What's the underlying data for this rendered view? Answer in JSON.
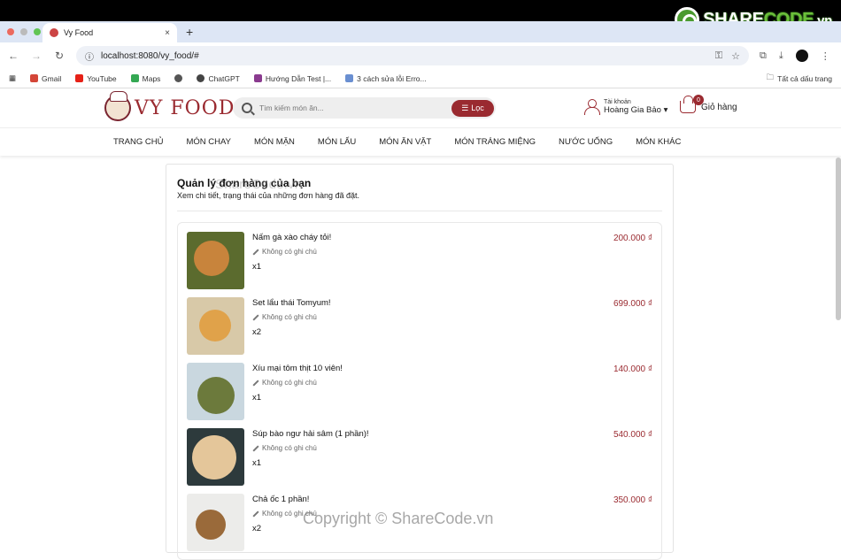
{
  "browser": {
    "tab_title": "Vy Food",
    "tab_close": "×",
    "new_tab": "+",
    "url": "localhost:8080/vy_food/#",
    "bookmarks": [
      {
        "label": "Gmail",
        "color": "#d44638"
      },
      {
        "label": "YouTube",
        "color": "#e62117"
      },
      {
        "label": "Maps",
        "color": "#34a853"
      },
      {
        "label": "",
        "color": "#555555"
      },
      {
        "label": "ChatGPT",
        "color": "#444444"
      },
      {
        "label": "Hướng Dẫn Test |...",
        "color": "#8a3b8f"
      },
      {
        "label": "3 cách sửa lỗi Erro...",
        "color": "#6a8fd1"
      }
    ],
    "bookmarks_all": "Tất cả dấu trang"
  },
  "watermark": {
    "logo_main": "SHARE",
    "logo_green": "CODE",
    "logo_suffix": ".vn",
    "top": "ShareCode.vn",
    "bottom": "Copyright © ShareCode.vn"
  },
  "site": {
    "logo_text": "VY FOOD",
    "search_placeholder": "Tìm kiếm món ăn...",
    "filter_label": "Lọc",
    "account_label": "Tài khoản",
    "account_name": "Hoàng Gia Bảo ▾",
    "cart_label": "Giỏ hàng",
    "cart_count": "0",
    "brand_color": "#9a2a30"
  },
  "nav": [
    "TRANG CHỦ",
    "MÓN CHAY",
    "MÓN MẶN",
    "MÓN LẨU",
    "MÓN ĂN VẶT",
    "MÓN TRÁNG MIỆNG",
    "NƯỚC UỐNG",
    "MÓN KHÁC"
  ],
  "page": {
    "title": "Quản lý đơn hàng của bạn",
    "subtitle": "Xem chi tiết, trạng thái của những đơn hàng đã đặt."
  },
  "orders": [
    {
      "name": "Nấm gà xào cháy tỏi!",
      "note": "Không có ghi chú",
      "qty": "x1",
      "price": "200.000 ₫",
      "bg": "#5b6b2e",
      "accent": "#c8843c"
    },
    {
      "name": "Set lẩu thái Tomyum!",
      "note": "Không có ghi chú",
      "qty": "x2",
      "price": "699.000 ₫",
      "bg": "#d8c9a8",
      "accent": "#e0a24a"
    },
    {
      "name": "Xíu mại tôm thịt 10 viên!",
      "note": "Không có ghi chú",
      "qty": "x1",
      "price": "140.000 ₫",
      "bg": "#c9d7df",
      "accent": "#6c7a3c"
    },
    {
      "name": "Súp bào ngư hải sâm (1 phần)!",
      "note": "Không có ghi chú",
      "qty": "x1",
      "price": "540.000 ₫",
      "bg": "#2d3a3c",
      "accent": "#e4c69a"
    },
    {
      "name": "Chả ốc 1 phần!",
      "note": "Không có ghi chú",
      "qty": "x2",
      "price": "350.000 ₫",
      "bg": "#ececea",
      "accent": "#9a6a3a"
    }
  ]
}
